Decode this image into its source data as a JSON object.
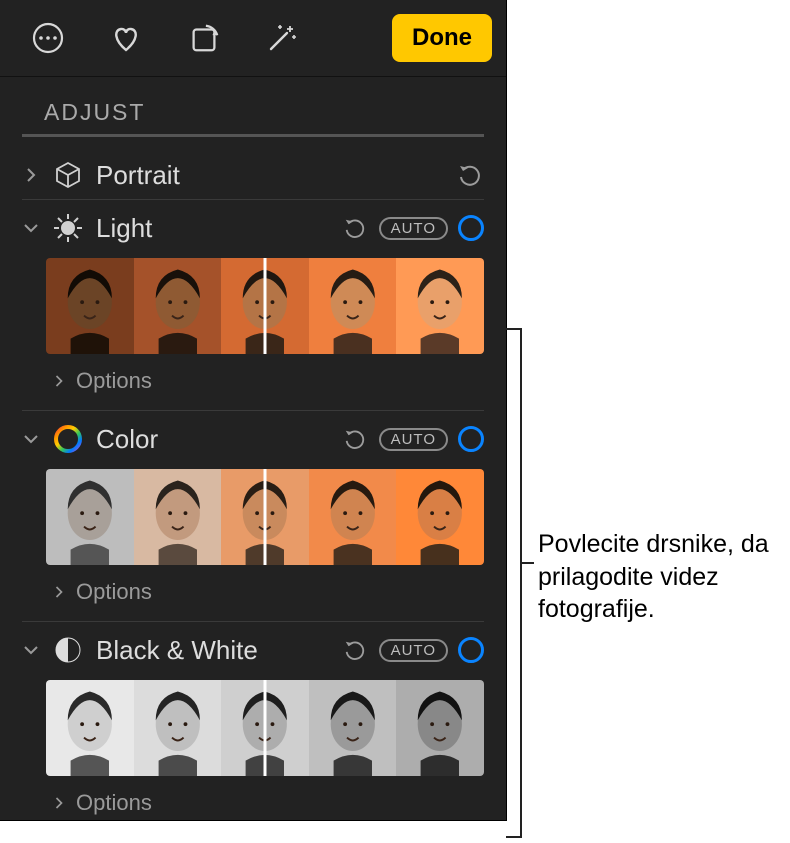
{
  "toolbar": {
    "done_label": "Done"
  },
  "adjust": {
    "label": "ADJUST"
  },
  "sections": {
    "portrait": {
      "title": "Portrait"
    },
    "light": {
      "title": "Light",
      "auto": "AUTO",
      "options": "Options"
    },
    "color": {
      "title": "Color",
      "auto": "AUTO",
      "options": "Options"
    },
    "bw": {
      "title": "Black & White",
      "auto": "AUTO",
      "options": "Options"
    }
  },
  "annotation": {
    "text": "Povlecite drsnike, da prilagodite videz fotografije."
  }
}
